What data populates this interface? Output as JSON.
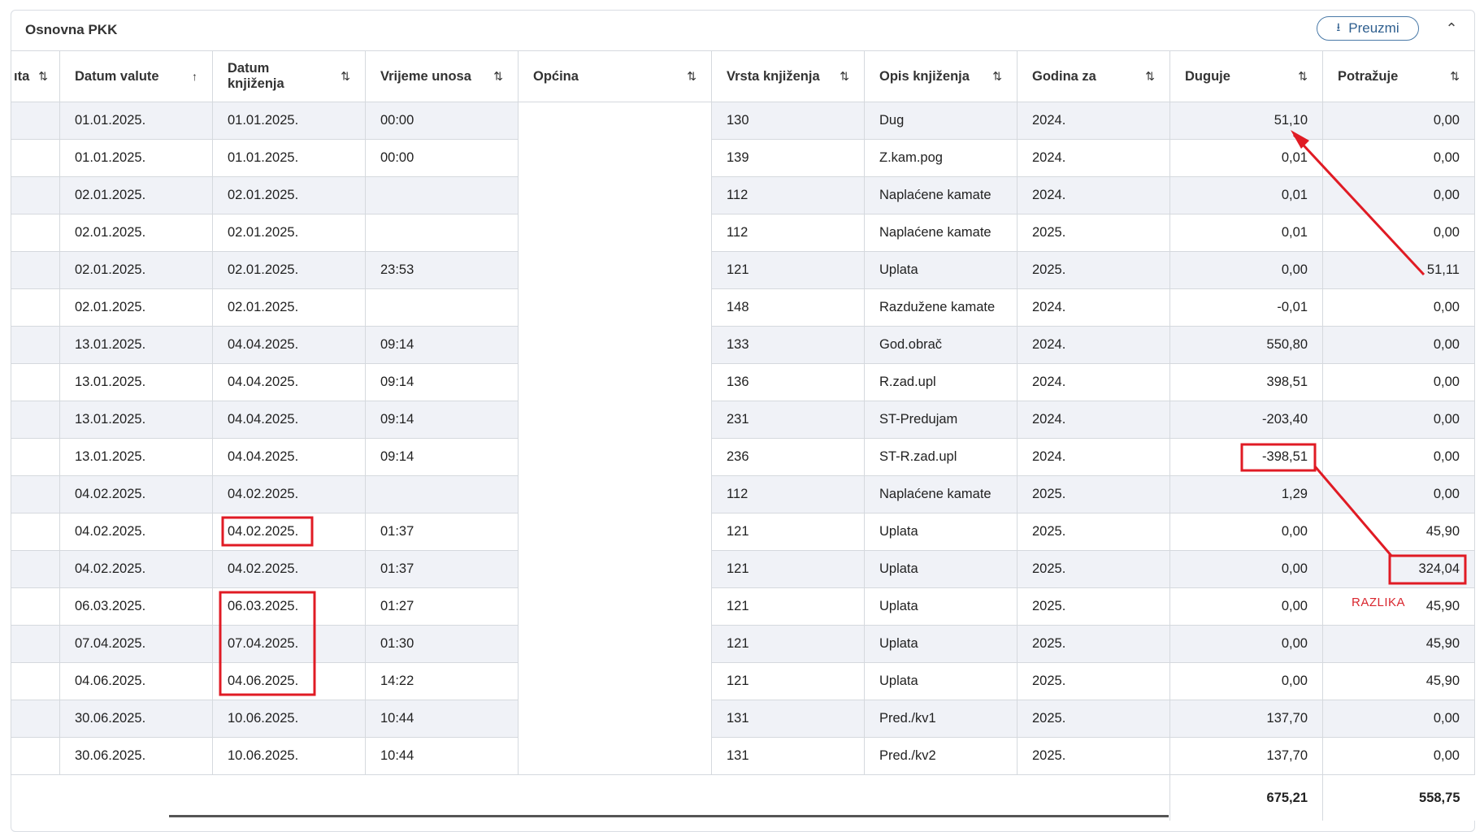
{
  "panel": {
    "title": "Osnovna PKK",
    "download_label": "Preuzmi",
    "download_icon": "download-icon",
    "collapse_icon": "chevron-up-icon"
  },
  "columns": [
    {
      "label": "ıta",
      "sort": "⇅"
    },
    {
      "label": "Datum valute",
      "sort": "↑"
    },
    {
      "label": "Datum knjiženja",
      "sort": "⇅"
    },
    {
      "label": "Vrijeme unosa",
      "sort": "⇅"
    },
    {
      "label": "Općina",
      "sort": "⇅"
    },
    {
      "label": "Vrsta knjiženja",
      "sort": "⇅"
    },
    {
      "label": "Opis knjiženja",
      "sort": "⇅"
    },
    {
      "label": "Godina za",
      "sort": "⇅"
    },
    {
      "label": "Duguje",
      "sort": "⇅"
    },
    {
      "label": "Potražuje",
      "sort": "⇅"
    }
  ],
  "rows": [
    {
      "valuta": "01.01.2025.",
      "knjizenje": "01.01.2025.",
      "vrijeme": "00:00",
      "vrsta": "130",
      "opis": "Dug",
      "godina": "2024.",
      "duguje": "51,10",
      "potrazuje": "0,00"
    },
    {
      "valuta": "01.01.2025.",
      "knjizenje": "01.01.2025.",
      "vrijeme": "00:00",
      "vrsta": "139",
      "opis": "Z.kam.pog",
      "godina": "2024.",
      "duguje": "0,01",
      "potrazuje": "0,00"
    },
    {
      "valuta": "02.01.2025.",
      "knjizenje": "02.01.2025.",
      "vrijeme": "",
      "vrsta": "112",
      "opis": "Naplaćene kamate",
      "godina": "2024.",
      "duguje": "0,01",
      "potrazuje": "0,00"
    },
    {
      "valuta": "02.01.2025.",
      "knjizenje": "02.01.2025.",
      "vrijeme": "",
      "vrsta": "112",
      "opis": "Naplaćene kamate",
      "godina": "2025.",
      "duguje": "0,01",
      "potrazuje": "0,00"
    },
    {
      "valuta": "02.01.2025.",
      "knjizenje": "02.01.2025.",
      "vrijeme": "23:53",
      "vrsta": "121",
      "opis": "Uplata",
      "godina": "2025.",
      "duguje": "0,00",
      "potrazuje": "51,11"
    },
    {
      "valuta": "02.01.2025.",
      "knjizenje": "02.01.2025.",
      "vrijeme": "",
      "vrsta": "148",
      "opis": "Razdužene kamate",
      "godina": "2024.",
      "duguje": "-0,01",
      "potrazuje": "0,00"
    },
    {
      "valuta": "13.01.2025.",
      "knjizenje": "04.04.2025.",
      "vrijeme": "09:14",
      "vrsta": "133",
      "opis": "God.obrač",
      "godina": "2024.",
      "duguje": "550,80",
      "potrazuje": "0,00"
    },
    {
      "valuta": "13.01.2025.",
      "knjizenje": "04.04.2025.",
      "vrijeme": "09:14",
      "vrsta": "136",
      "opis": "R.zad.upl",
      "godina": "2024.",
      "duguje": "398,51",
      "potrazuje": "0,00"
    },
    {
      "valuta": "13.01.2025.",
      "knjizenje": "04.04.2025.",
      "vrijeme": "09:14",
      "vrsta": "231",
      "opis": "ST-Predujam",
      "godina": "2024.",
      "duguje": "-203,40",
      "potrazuje": "0,00"
    },
    {
      "valuta": "13.01.2025.",
      "knjizenje": "04.04.2025.",
      "vrijeme": "09:14",
      "vrsta": "236",
      "opis": "ST-R.zad.upl",
      "godina": "2024.",
      "duguje": "-398,51",
      "potrazuje": "0,00"
    },
    {
      "valuta": "04.02.2025.",
      "knjizenje": "04.02.2025.",
      "vrijeme": "",
      "vrsta": "112",
      "opis": "Naplaćene kamate",
      "godina": "2025.",
      "duguje": "1,29",
      "potrazuje": "0,00"
    },
    {
      "valuta": "04.02.2025.",
      "knjizenje": "04.02.2025.",
      "vrijeme": "01:37",
      "vrsta": "121",
      "opis": "Uplata",
      "godina": "2025.",
      "duguje": "0,00",
      "potrazuje": "45,90"
    },
    {
      "valuta": "04.02.2025.",
      "knjizenje": "04.02.2025.",
      "vrijeme": "01:37",
      "vrsta": "121",
      "opis": "Uplata",
      "godina": "2025.",
      "duguje": "0,00",
      "potrazuje": "324,04"
    },
    {
      "valuta": "06.03.2025.",
      "knjizenje": "06.03.2025.",
      "vrijeme": "01:27",
      "vrsta": "121",
      "opis": "Uplata",
      "godina": "2025.",
      "duguje": "0,00",
      "potrazuje": "45,90"
    },
    {
      "valuta": "07.04.2025.",
      "knjizenje": "07.04.2025.",
      "vrijeme": "01:30",
      "vrsta": "121",
      "opis": "Uplata",
      "godina": "2025.",
      "duguje": "0,00",
      "potrazuje": "45,90"
    },
    {
      "valuta": "04.06.2025.",
      "knjizenje": "04.06.2025.",
      "vrijeme": "14:22",
      "vrsta": "121",
      "opis": "Uplata",
      "godina": "2025.",
      "duguje": "0,00",
      "potrazuje": "45,90"
    },
    {
      "valuta": "30.06.2025.",
      "knjizenje": "10.06.2025.",
      "vrijeme": "10:44",
      "vrsta": "131",
      "opis": "Pred./kv1",
      "godina": "2025.",
      "duguje": "137,70",
      "potrazuje": "0,00"
    },
    {
      "valuta": "30.06.2025.",
      "knjizenje": "10.06.2025.",
      "vrijeme": "10:44",
      "vrsta": "131",
      "opis": "Pred./kv2",
      "godina": "2025.",
      "duguje": "137,70",
      "potrazuje": "0,00"
    }
  ],
  "totals": {
    "duguje": "675,21",
    "potrazuje": "558,75"
  },
  "annotation": {
    "label": "RAZLIKA",
    "color": "#e01b24"
  }
}
